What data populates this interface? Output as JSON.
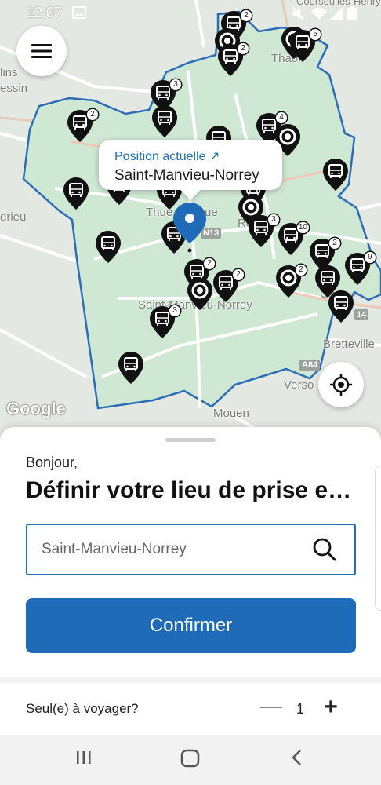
{
  "status_bar": {
    "time": "12:07"
  },
  "map": {
    "labels": {
      "partial_top": "Courseulles-Henry",
      "lins": "lins",
      "essin": "essin",
      "thaon": "Thaon",
      "rieu": "drieu",
      "thue": "Thue",
      "rue": "rue",
      "ro": "Ro",
      "carp": "Carp",
      "saint_manvieu": "Saint-Manvieu-Norrey",
      "bretteville": "Bretteville",
      "verso": "Verso",
      "mouen": "Mouen"
    },
    "road_badges": {
      "n13": "N13",
      "a84": "A84",
      "n14": "14"
    },
    "google_logo": "Google",
    "stops_counts": [
      "2",
      "2",
      "5",
      "3",
      "2",
      "4",
      "3",
      "10",
      "2",
      "9",
      "2",
      "2",
      "2",
      "3"
    ],
    "accent_color": "#1f6fb3",
    "zone_fill": "#cfe8d4",
    "zone_border": "#2b6db6"
  },
  "tooltip": {
    "caption": "Position actuelle ↗",
    "place": "Saint-Manvieu-Norrey"
  },
  "sheet": {
    "greeting": "Bonjour,",
    "title": "Définir votre lieu de prise e…",
    "search": {
      "placeholder": "Saint-Manvieu-Norrey",
      "value": ""
    },
    "confirm_label": "Confirmer",
    "solo_label": "Seul(e) à voyager?",
    "passenger_count": "1",
    "minus": "—",
    "plus": "+"
  },
  "icons": {
    "menu": "hamburger-icon",
    "locate": "crosshair-icon",
    "search": "search-icon",
    "stop": "bus-stop-pin-icon",
    "current": "current-location-pin-icon"
  },
  "colors": {
    "primary": "#1f6bb8"
  }
}
